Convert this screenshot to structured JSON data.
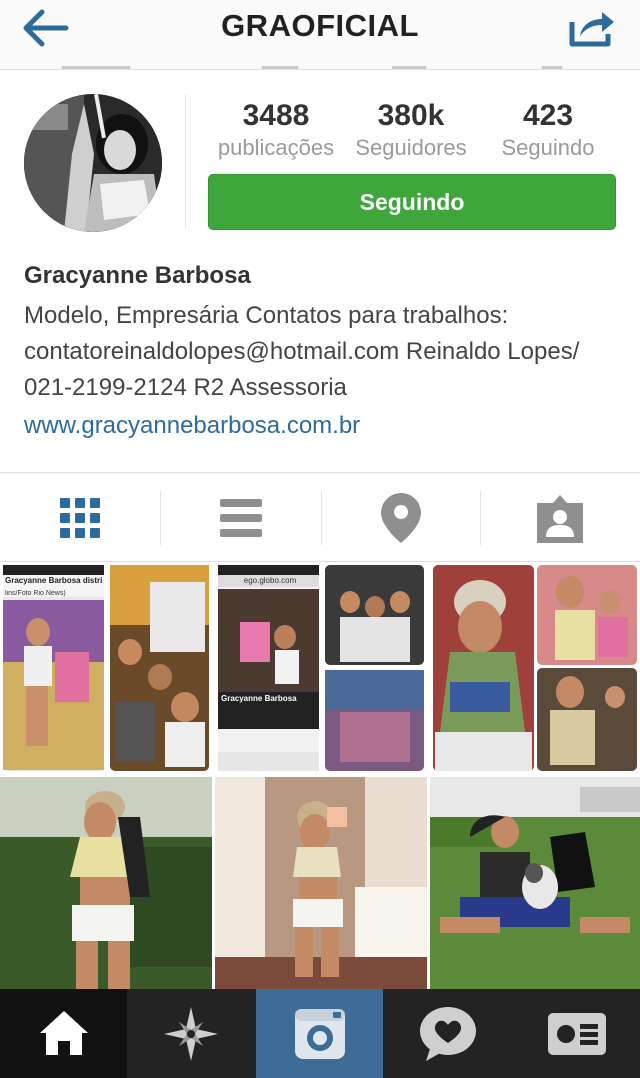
{
  "header": {
    "title": "GRAOFICIAL"
  },
  "profile": {
    "stats": [
      {
        "value": "3488",
        "label": "publicações"
      },
      {
        "value": "380k",
        "label": "Seguidores"
      },
      {
        "value": "423",
        "label": "Seguindo"
      }
    ],
    "follow_button": "Seguindo",
    "full_name": "Gracyanne Barbosa",
    "bio": "Modelo, Empresária Contatos para trabalhos: contatoreinaldolopes@hotmail.com Reinaldo Lopes/ 021-2199-2124 R2 Assessoria",
    "website": "www.gracyannebarbosa.com.br"
  },
  "view_tabs": [
    "grid-view",
    "list-view",
    "map-view",
    "tagged-view"
  ],
  "grid_thumb_text": {
    "screenshot1_headline": "Gracyanne Barbosa distribui br...",
    "screenshot1_caption": "lins/Foto Rio News)",
    "screenshot2_url": "ego.globo.com",
    "screenshot2_name": "Gracyanne Barbosa"
  },
  "bottom_nav": [
    "home",
    "explore",
    "camera",
    "activity",
    "profile"
  ],
  "colors": {
    "accent_blue": "#2c6b9b",
    "follow_green": "#3ea63b",
    "bottom_bar": "#232323",
    "active_tab": "#3d6d96"
  }
}
